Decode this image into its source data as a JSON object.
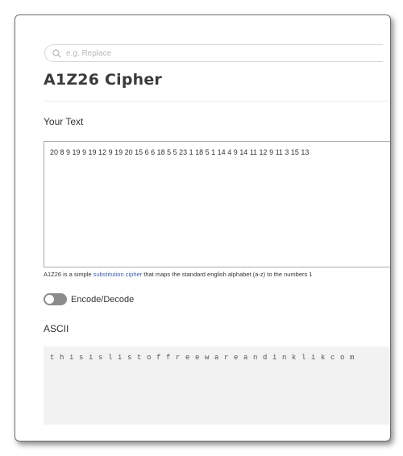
{
  "search": {
    "placeholder": "e.g. Replace",
    "icon": "search-icon"
  },
  "page": {
    "title": "A1Z26 Cipher"
  },
  "input_section": {
    "label": "Your Text",
    "value": "20 8 9 19 9 19 12 9 19 20 15 6 6 18 5 5 23 1 18 5 1 14 4 9 14 11 12 9 11 3 15 13"
  },
  "help": {
    "prefix": "A1Z26 is a simple ",
    "link_text": "substitution cipher",
    "suffix": " that maps the standard english alphabet (a-z) to the numbers 1"
  },
  "toggle": {
    "label": "Encode/Decode",
    "state": "off"
  },
  "output_section": {
    "label": "ASCII",
    "value": "thisislistoffreewareandinklikcom"
  },
  "colors": {
    "link": "#3f5ea8",
    "toggle_track": "#8c8c8c",
    "output_bg": "#f2f2f2"
  }
}
